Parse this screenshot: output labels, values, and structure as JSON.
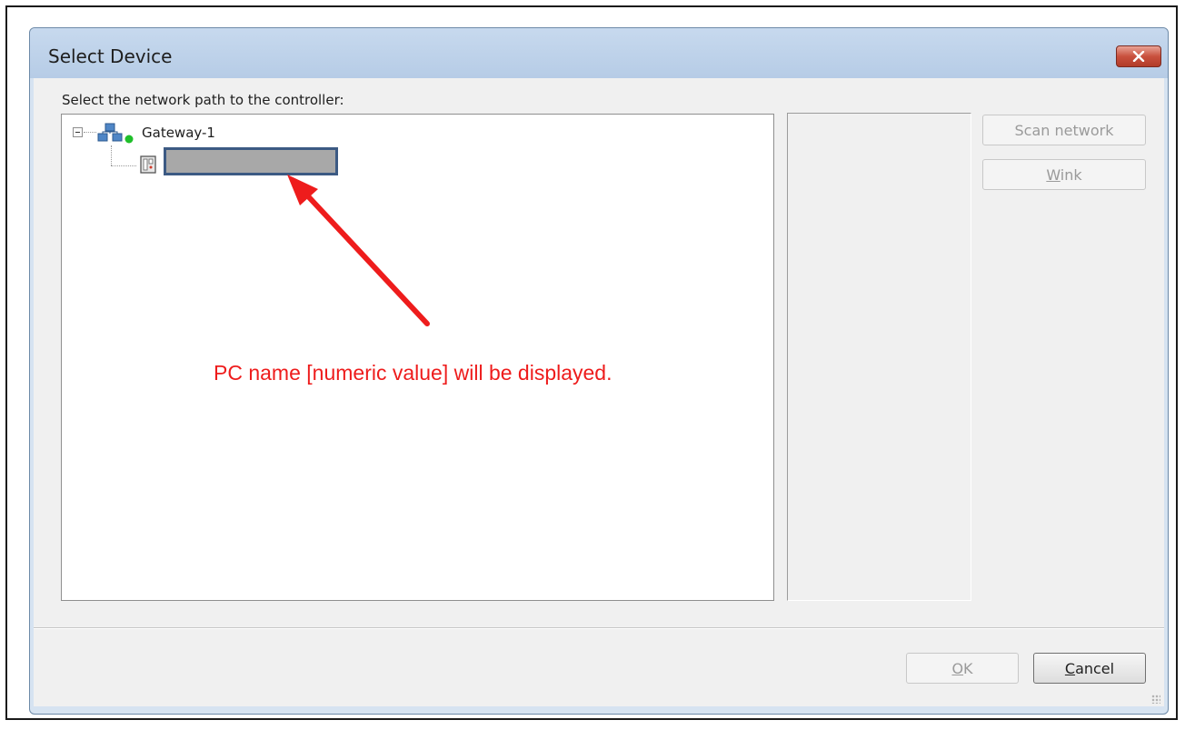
{
  "dialog": {
    "title": "Select Device",
    "close_icon": "close-icon",
    "prompt": "Select the network path to the controller:"
  },
  "tree": {
    "root": {
      "label": "Gateway-1",
      "icon": "network-gateway-icon",
      "status_color": "#1fbf2a",
      "expanded": true
    },
    "child": {
      "icon": "pc-icon",
      "value": ""
    }
  },
  "annotation": {
    "text": "PC name [numeric value] will be displayed.",
    "color": "#ee1c1c"
  },
  "buttons": {
    "scan_network": "Scan network",
    "wink_rest": "ink",
    "wink_mnemonic": "W",
    "ok_rest": "K",
    "ok_mnemonic": "O",
    "cancel_rest": "ancel",
    "cancel_mnemonic": "C"
  },
  "colors": {
    "title_bar": "#b6cce6",
    "selection_border": "#3c5a83",
    "annotation": "#ee1c1c"
  }
}
